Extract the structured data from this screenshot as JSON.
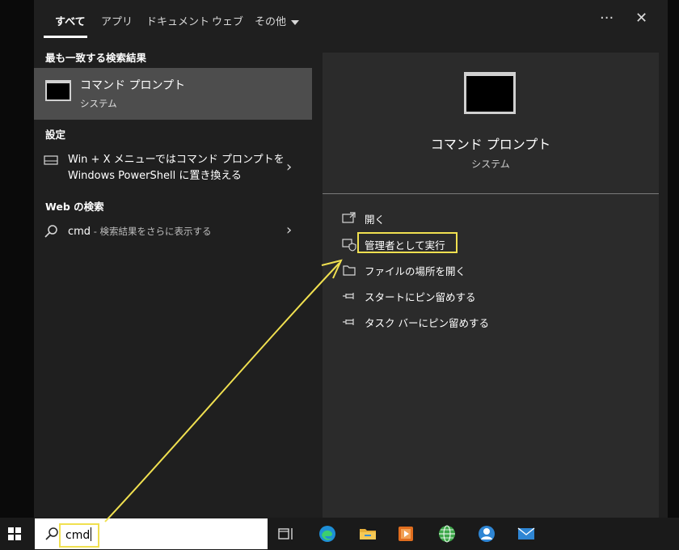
{
  "tabs": [
    {
      "label": "すべて"
    },
    {
      "label": "アプリ"
    },
    {
      "label": "ドキュメント"
    },
    {
      "label": "ウェブ"
    },
    {
      "label": "その他"
    }
  ],
  "top_icons": {
    "more": "···",
    "close": "✕"
  },
  "left": {
    "best_match_header": "最も一致する検索結果",
    "best_match": {
      "title": "コマンド プロンプト",
      "subtitle": "システム"
    },
    "settings_header": "設定",
    "settings_item": {
      "line1": "Win + X メニューではコマンド プロンプトを",
      "line2": "Windows PowerShell に置き換える"
    },
    "web_header": "Web の検索",
    "web_item": {
      "query": "cmd",
      "suffix": " - 検索結果をさらに表示する"
    },
    "chevron": "›"
  },
  "preview": {
    "title": "コマンド プロンプト",
    "subtitle": "システム",
    "actions": [
      {
        "label": "開く",
        "icon": "open-window-icon"
      },
      {
        "label": "管理者として実行",
        "icon": "shield-admin-icon"
      },
      {
        "label": "ファイルの場所を開く",
        "icon": "file-location-icon"
      },
      {
        "label": "スタートにピン留めする",
        "icon": "pin-icon"
      },
      {
        "label": "タスク バーにピン留めする",
        "icon": "pin-icon"
      }
    ]
  },
  "taskbar": {
    "search_value": "cmd",
    "icons": [
      "task-view-icon",
      "edge-icon",
      "file-explorer-icon",
      "media-player-icon",
      "network-globe-icon",
      "account-icon",
      "mail-icon"
    ]
  },
  "colors": {
    "highlight": "#f0e050",
    "selected": "#4d4d4d",
    "panel": "#1f1f1f",
    "preview": "#2b2b2b"
  }
}
